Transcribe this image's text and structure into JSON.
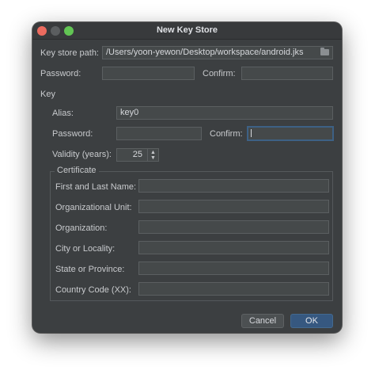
{
  "window": {
    "title": "New Key Store"
  },
  "keystore": {
    "path_label": "Key store path:",
    "path_value": "/Users/yoon-yewon/Desktop/workspace/android.jks",
    "password_label": "Password:",
    "password_value": "",
    "confirm_label": "Confirm:",
    "confirm_value": ""
  },
  "key": {
    "section_label": "Key",
    "alias_label": "Alias:",
    "alias_value": "key0",
    "password_label": "Password:",
    "password_value": "",
    "confirm_label": "Confirm:",
    "confirm_value": "",
    "validity_label": "Validity (years):",
    "validity_value": "25"
  },
  "certificate": {
    "legend": "Certificate",
    "fields": [
      {
        "label": "First and Last Name:",
        "value": ""
      },
      {
        "label": "Organizational Unit:",
        "value": ""
      },
      {
        "label": "Organization:",
        "value": ""
      },
      {
        "label": "City or Locality:",
        "value": ""
      },
      {
        "label": "State or Province:",
        "value": ""
      },
      {
        "label": "Country Code (XX):",
        "value": ""
      }
    ]
  },
  "buttons": {
    "cancel": "Cancel",
    "ok": "OK"
  },
  "icons": {
    "browse": "folder-icon",
    "spinner_up": "▲",
    "spinner_down": "▼"
  },
  "colors": {
    "window_bg": "#3c3f41",
    "accent": "#365880",
    "focus_border": "#3d6185"
  }
}
